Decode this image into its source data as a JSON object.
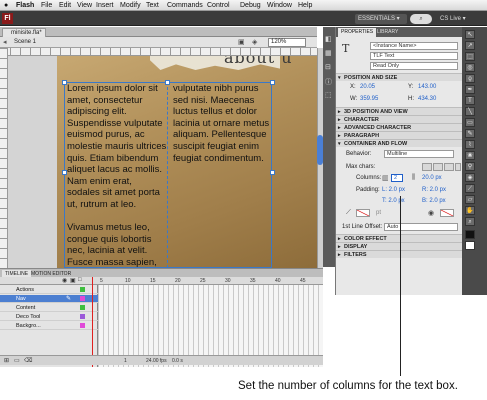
{
  "menu": {
    "apple": "",
    "app": "Flash",
    "items": [
      "File",
      "Edit",
      "View",
      "Insert",
      "Modify",
      "Text",
      "Commands",
      "Control",
      "Debug",
      "Window",
      "Help"
    ]
  },
  "appbar": {
    "logo": "Fl",
    "workspace": "ESSENTIALS ▾",
    "search": "",
    "cslive": "CS Live ▾"
  },
  "doc": {
    "tab": "minisite.fla*",
    "scene": "Scene 1",
    "zoom": "120%"
  },
  "stage": {
    "headline": "about u",
    "col1": "Lorem ipsum dolor sit\namet, consectetur\nadipiscing elit.\nSuspendisse vulputate\neuismod purus, ac\nmolestie mauris ultrices\nquis. Etiam bibendum\naliquet lacus ac mollis.\nNam enim erat,\nsodales sit amet porta\nut, rutrum at leo.\n\n Vivamus metus leo,\ncongue quis lobortis\nnec, lacinia at velit.\nFusce massa sapien,",
    "col2": "vulputate nibh purus\nsed nisi. Maecenas\nluctus tellus et dolor\nlacinia ut ornare metus\naliquam. Pellentesque\nsuscipit feugiat enim\nfeugiat condimentum."
  },
  "panel": {
    "tabs": [
      "PROPERTIES",
      "LIBRARY"
    ],
    "instance": "<Instance Name>",
    "type": "TLF Text",
    "mode": "Read Only",
    "position_section": "POSITION AND SIZE",
    "x_label": "X:",
    "x": "20.05",
    "y_label": "Y:",
    "y": "143.00",
    "w_label": "W:",
    "w": "359.95",
    "h_label": "H:",
    "h": "434.30",
    "sections": [
      "3D POSITION AND VIEW",
      "CHARACTER",
      "ADVANCED CHARACTER",
      "PARAGRAPH"
    ],
    "container_section": "CONTAINER AND FLOW",
    "behavior_label": "Behavior:",
    "behavior": "Multiline",
    "maxchars_label": "Max chars:",
    "columns_label": "Columns:",
    "columns": "2",
    "gutter": "20.0 px",
    "padding_label": "Padding:",
    "pad_l": "L: 2.0 px",
    "pad_r": "R: 2.0 px",
    "pad_t": "T: 2.0 px",
    "pad_b": "B: 2.0 px",
    "pt": "pt",
    "offset_label": "1st Line Offset:",
    "offset": "Auto",
    "bottom_sections": [
      "COLOR EFFECT",
      "DISPLAY",
      "FILTERS"
    ]
  },
  "timeline": {
    "tabs": [
      "TIMELINE",
      "MOTION EDITOR"
    ],
    "layers": [
      "Actions",
      "Nav",
      "Content",
      "Deco Tool",
      "Backgro..."
    ],
    "frame_numbers": [
      "5",
      "10",
      "15",
      "20",
      "25",
      "30",
      "35",
      "40",
      "45"
    ],
    "footer": {
      "frame": "1",
      "fps": "24.00 fps",
      "time": "0.0 s"
    }
  },
  "caption": "Set the number of columns for the text box."
}
